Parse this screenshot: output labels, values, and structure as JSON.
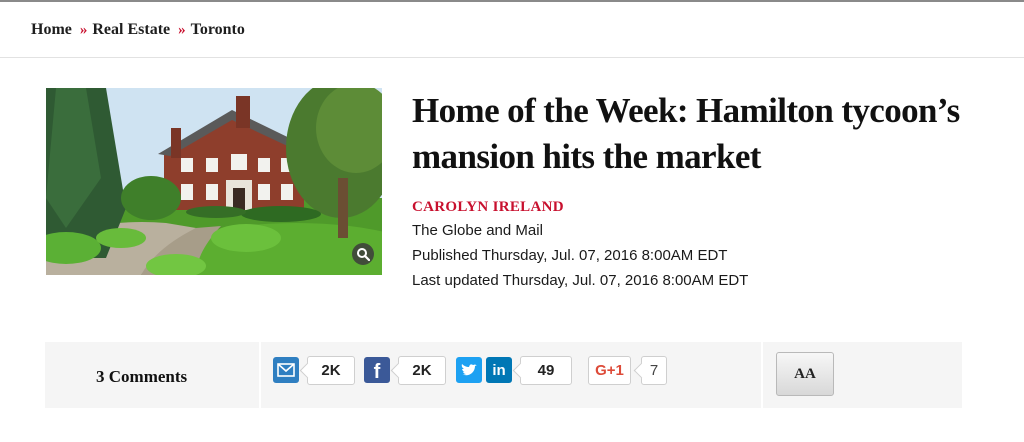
{
  "breadcrumb": {
    "items": [
      "Home",
      "Real Estate",
      "Toronto"
    ],
    "separator": "»"
  },
  "article": {
    "headline_line1": "Home of the Week: Hamilton tycoon’s",
    "headline_line2": "mansion hits the market",
    "author": "CAROLYN IRELAND",
    "source": "The Globe and Mail",
    "published": "Published Thursday, Jul. 07, 2016 8:00AM EDT",
    "updated": "Last updated Thursday, Jul. 07, 2016 8:00AM EDT"
  },
  "media": {
    "hero_icon": "house-photo",
    "zoom_icon": "magnifier-icon"
  },
  "share": {
    "comments": "3 Comments",
    "buttons": [
      {
        "name": "email",
        "icon": "envelope-icon",
        "count": "2K",
        "color": "#2f7fc1"
      },
      {
        "name": "facebook",
        "icon": "facebook-icon",
        "count": "2K",
        "color": "#3b5998"
      },
      {
        "name": "twitter",
        "icon": "twitter-icon",
        "color": "#1da1f2"
      },
      {
        "name": "linkedin",
        "icon": "linkedin-icon",
        "count": "49",
        "color": "#0077b5"
      },
      {
        "name": "googleplus",
        "icon": "gplus-icon",
        "label": "G+1",
        "count": "7",
        "color": "#dd4b39"
      }
    ],
    "font_size_button": "AA"
  },
  "colors": {
    "accent": "#c8102e",
    "share_bar_bg": "#f5f5f5"
  }
}
